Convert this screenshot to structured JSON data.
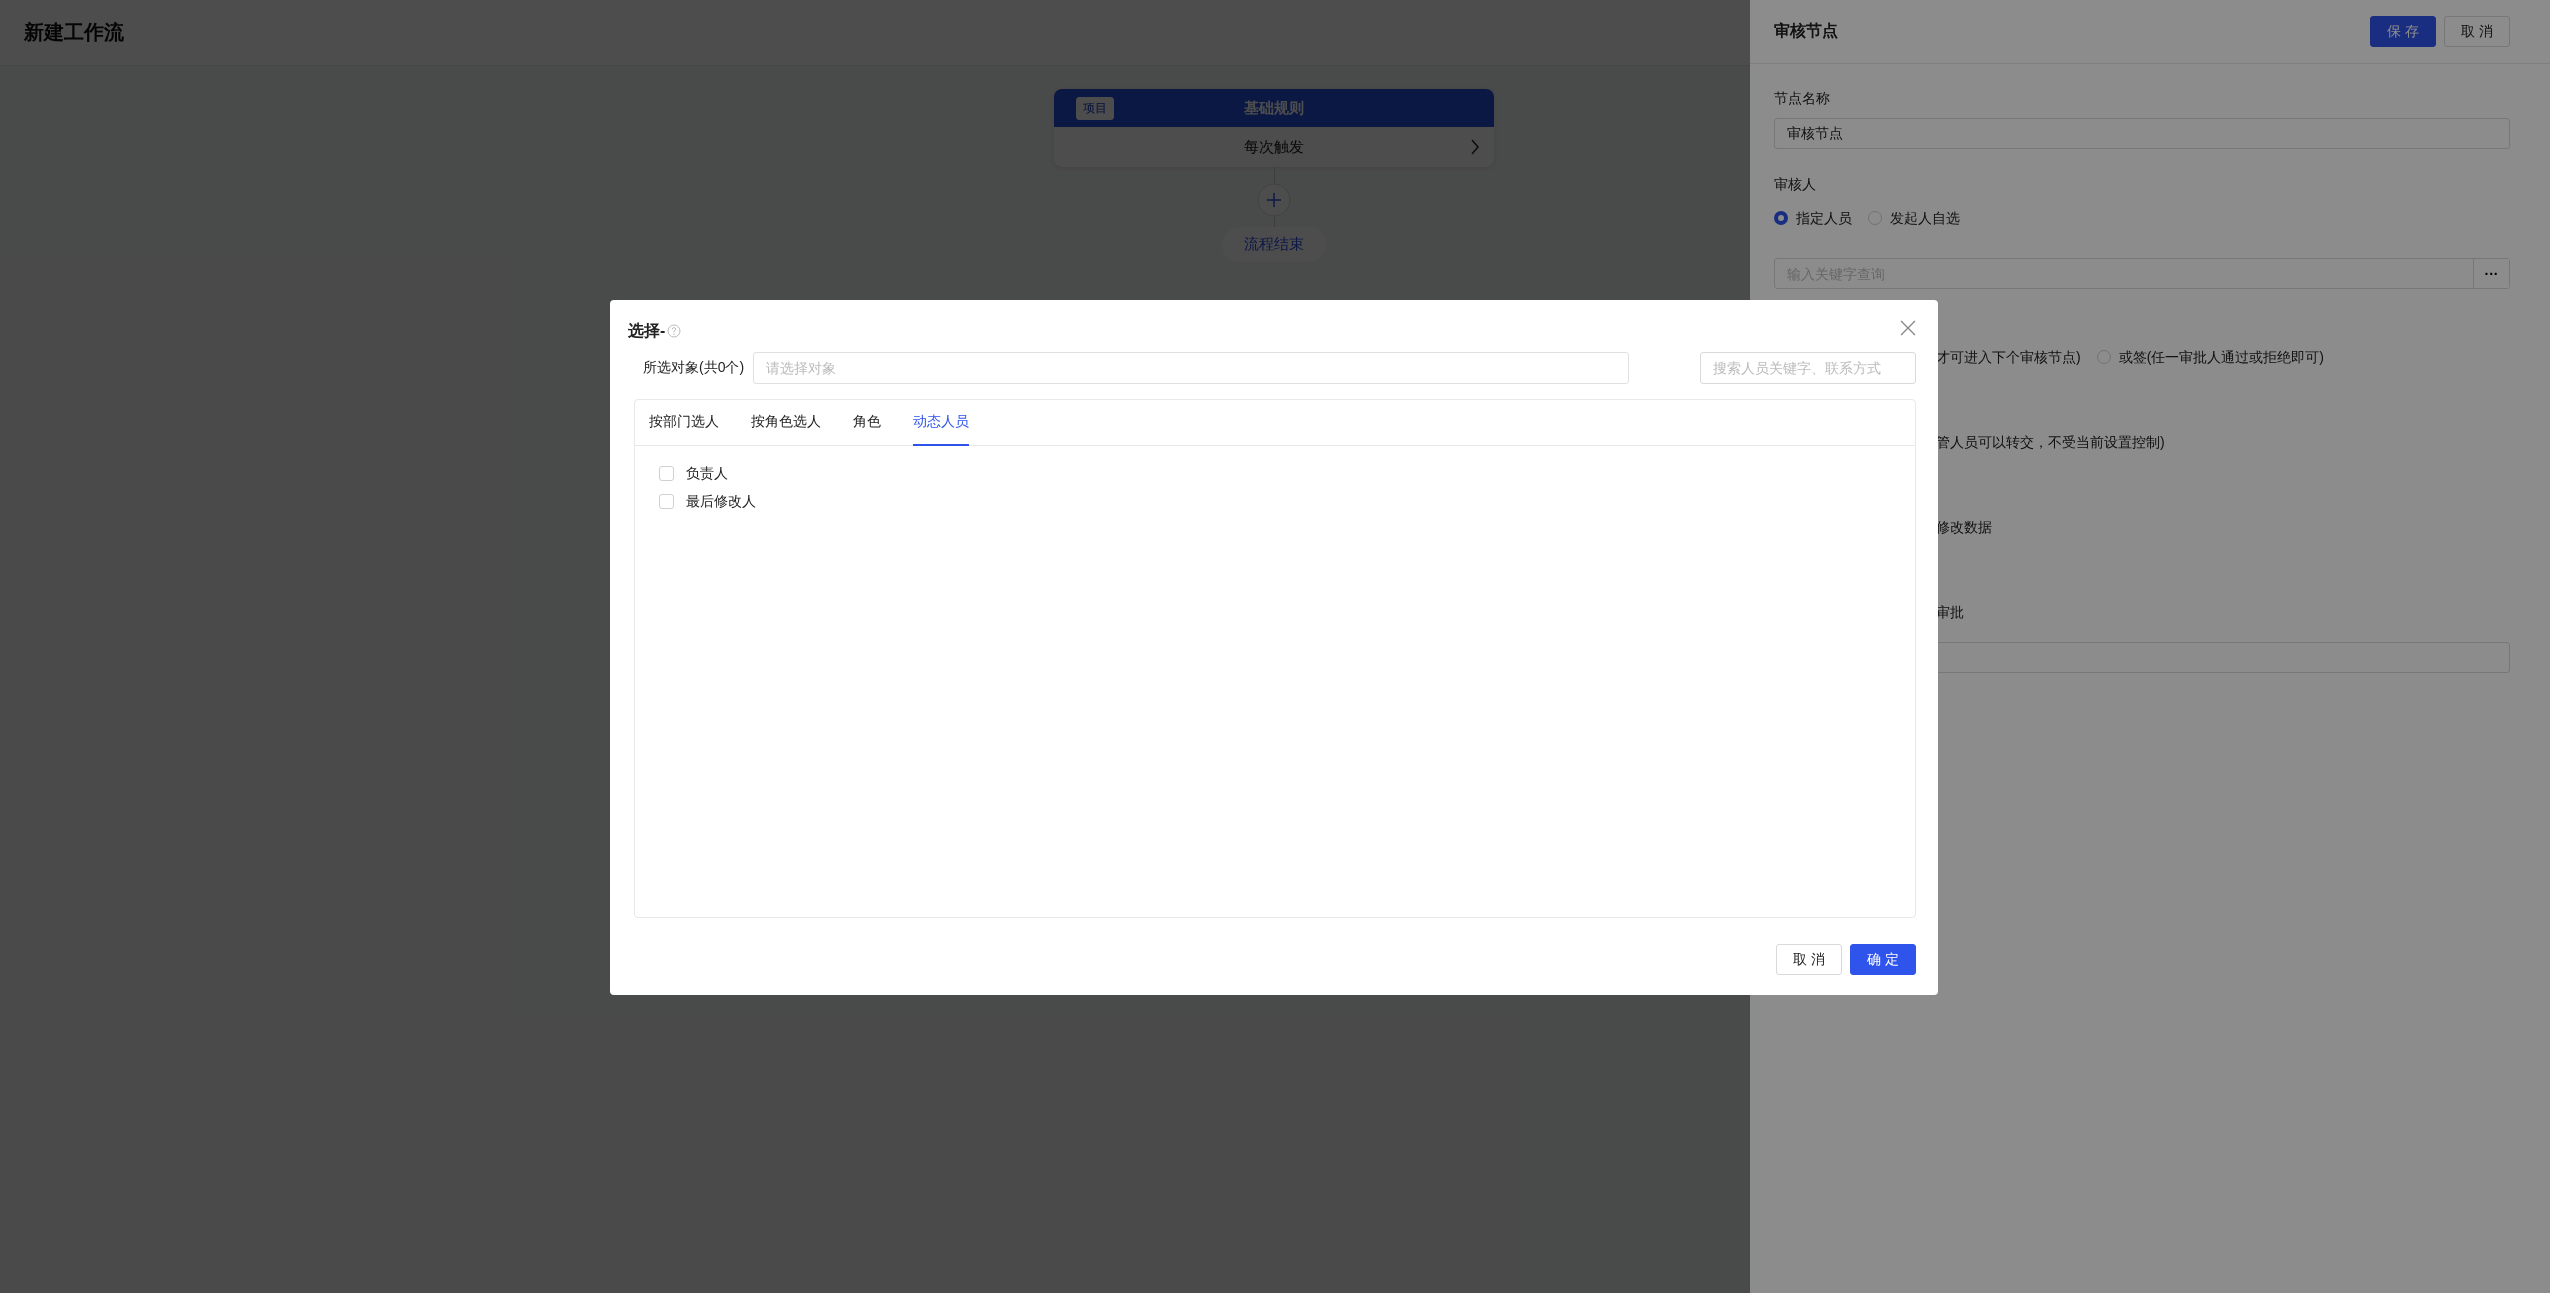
{
  "page": {
    "title": "新建工作流"
  },
  "flow": {
    "node": {
      "tag": "项目",
      "title": "基础规则",
      "trigger": "每次触发"
    },
    "end_label": "流程结束"
  },
  "drawer": {
    "title": "审核节点",
    "buttons": [
      {
        "label": "保 存",
        "kind": "primary"
      },
      {
        "label": "取 消",
        "kind": "default"
      }
    ],
    "node_name": {
      "label": "节点名称",
      "value": "审核节点"
    },
    "reviewer": {
      "label": "审核人",
      "options": [
        {
          "label": "指定人员",
          "selected": true
        },
        {
          "label": "发起人自选",
          "selected": false
        }
      ],
      "search_placeholder": "输入关键字查询",
      "more_button": "···"
    },
    "approval_mode": {
      "visible_text": "才可进入下个审核节点)",
      "option": {
        "label": "或签(任一审批人通过或拒绝即可)",
        "selected": false
      }
    },
    "partial_lines": [
      "管人员可以转交，不受当前设置控制)",
      "修改数据",
      "审批"
    ]
  },
  "dialog": {
    "title": "选择-",
    "selected_label": "所选对象(共0个)",
    "selected_placeholder": "请选择对象",
    "search_placeholder": "搜索人员关键字、联系方式",
    "tabs": [
      {
        "label": "按部门选人",
        "selected": false
      },
      {
        "label": "按角色选人",
        "selected": false
      },
      {
        "label": "角色",
        "selected": false
      },
      {
        "label": "动态人员",
        "selected": true
      }
    ],
    "options": [
      {
        "label": "负责人",
        "checked": false
      },
      {
        "label": "最后修改人",
        "checked": false
      }
    ],
    "buttons": [
      {
        "label": "取 消",
        "kind": "default"
      },
      {
        "label": "确 定",
        "kind": "primary"
      }
    ]
  }
}
